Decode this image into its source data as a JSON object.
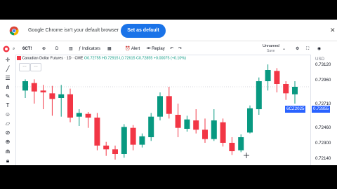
{
  "banner": {
    "message": "Google Chrome isn't your default browser",
    "button_label": "Set as default",
    "close_glyph": "✕"
  },
  "toolbar": {
    "symbol": "6CT!",
    "add_glyph": "⊕",
    "interval": "D",
    "indicators_label": "Indicators",
    "alert_label": "Alert",
    "replay_label": "Replay",
    "layout_name": "Unnamed",
    "save_label": "Save"
  },
  "legend": {
    "title": "Canadian Dollar Futures · 1D · CME",
    "o": "O0.72755",
    "h": "H0.72915",
    "l": "L0.72615",
    "c": "C0.72855",
    "change": "+0.00075 (+0.10%)"
  },
  "price_axis": {
    "currency": "USD",
    "symbol_tag": "6CZ2025",
    "current_price": "0.72855",
    "labels": [
      "0.73120",
      "0.72960",
      "0.72710",
      "0.72460",
      "0.72300",
      "0.72140"
    ]
  },
  "colors": {
    "up": "#089981",
    "down": "#f23645",
    "accent": "#2962ff",
    "chrome_button": "#1a73e8"
  },
  "chart_data": {
    "type": "candlestick",
    "ylim": [
      0.7208,
      0.7316
    ],
    "candles": [
      {
        "o": 0.7282,
        "h": 0.7294,
        "l": 0.7274,
        "c": 0.7292
      },
      {
        "o": 0.729,
        "h": 0.7294,
        "l": 0.7268,
        "c": 0.7281
      },
      {
        "o": 0.7282,
        "h": 0.7288,
        "l": 0.7262,
        "c": 0.728
      },
      {
        "o": 0.7279,
        "h": 0.7287,
        "l": 0.7255,
        "c": 0.7273
      },
      {
        "o": 0.7274,
        "h": 0.7288,
        "l": 0.7254,
        "c": 0.7278
      },
      {
        "o": 0.7278,
        "h": 0.7284,
        "l": 0.7248,
        "c": 0.7253
      },
      {
        "o": 0.7254,
        "h": 0.7262,
        "l": 0.7244,
        "c": 0.7258
      },
      {
        "o": 0.7257,
        "h": 0.7259,
        "l": 0.7242,
        "c": 0.7253
      },
      {
        "o": 0.7253,
        "h": 0.7258,
        "l": 0.7218,
        "c": 0.7223
      },
      {
        "o": 0.7223,
        "h": 0.7227,
        "l": 0.7212,
        "c": 0.7219
      },
      {
        "o": 0.7219,
        "h": 0.7223,
        "l": 0.7208,
        "c": 0.7214
      },
      {
        "o": 0.7214,
        "h": 0.7246,
        "l": 0.721,
        "c": 0.7243
      },
      {
        "o": 0.7242,
        "h": 0.7245,
        "l": 0.7218,
        "c": 0.7224
      },
      {
        "o": 0.7224,
        "h": 0.7236,
        "l": 0.7221,
        "c": 0.7233
      },
      {
        "o": 0.7232,
        "h": 0.7258,
        "l": 0.7228,
        "c": 0.7254
      },
      {
        "o": 0.7254,
        "h": 0.728,
        "l": 0.725,
        "c": 0.7276
      },
      {
        "o": 0.7276,
        "h": 0.7286,
        "l": 0.7252,
        "c": 0.7257
      },
      {
        "o": 0.7256,
        "h": 0.7268,
        "l": 0.7232,
        "c": 0.7242
      },
      {
        "o": 0.7241,
        "h": 0.7255,
        "l": 0.7238,
        "c": 0.7251
      },
      {
        "o": 0.725,
        "h": 0.7262,
        "l": 0.7236,
        "c": 0.724
      },
      {
        "o": 0.724,
        "h": 0.7252,
        "l": 0.7226,
        "c": 0.723
      },
      {
        "o": 0.723,
        "h": 0.7262,
        "l": 0.7228,
        "c": 0.725
      },
      {
        "o": 0.7248,
        "h": 0.7252,
        "l": 0.7222,
        "c": 0.7226
      },
      {
        "o": 0.7226,
        "h": 0.7232,
        "l": 0.7213,
        "c": 0.7217
      },
      {
        "o": 0.7218,
        "h": 0.7235,
        "l": 0.7216,
        "c": 0.7232
      },
      {
        "o": 0.7237,
        "h": 0.7266,
        "l": 0.7236,
        "c": 0.7263
      },
      {
        "o": 0.7262,
        "h": 0.7296,
        "l": 0.7256,
        "c": 0.7292
      },
      {
        "o": 0.7292,
        "h": 0.731,
        "l": 0.7282,
        "c": 0.7304
      },
      {
        "o": 0.7303,
        "h": 0.7306,
        "l": 0.728,
        "c": 0.7289
      },
      {
        "o": 0.7289,
        "h": 0.7292,
        "l": 0.7272,
        "c": 0.7279
      },
      {
        "o": 0.7278,
        "h": 0.7292,
        "l": 0.7268,
        "c": 0.7286
      }
    ]
  }
}
